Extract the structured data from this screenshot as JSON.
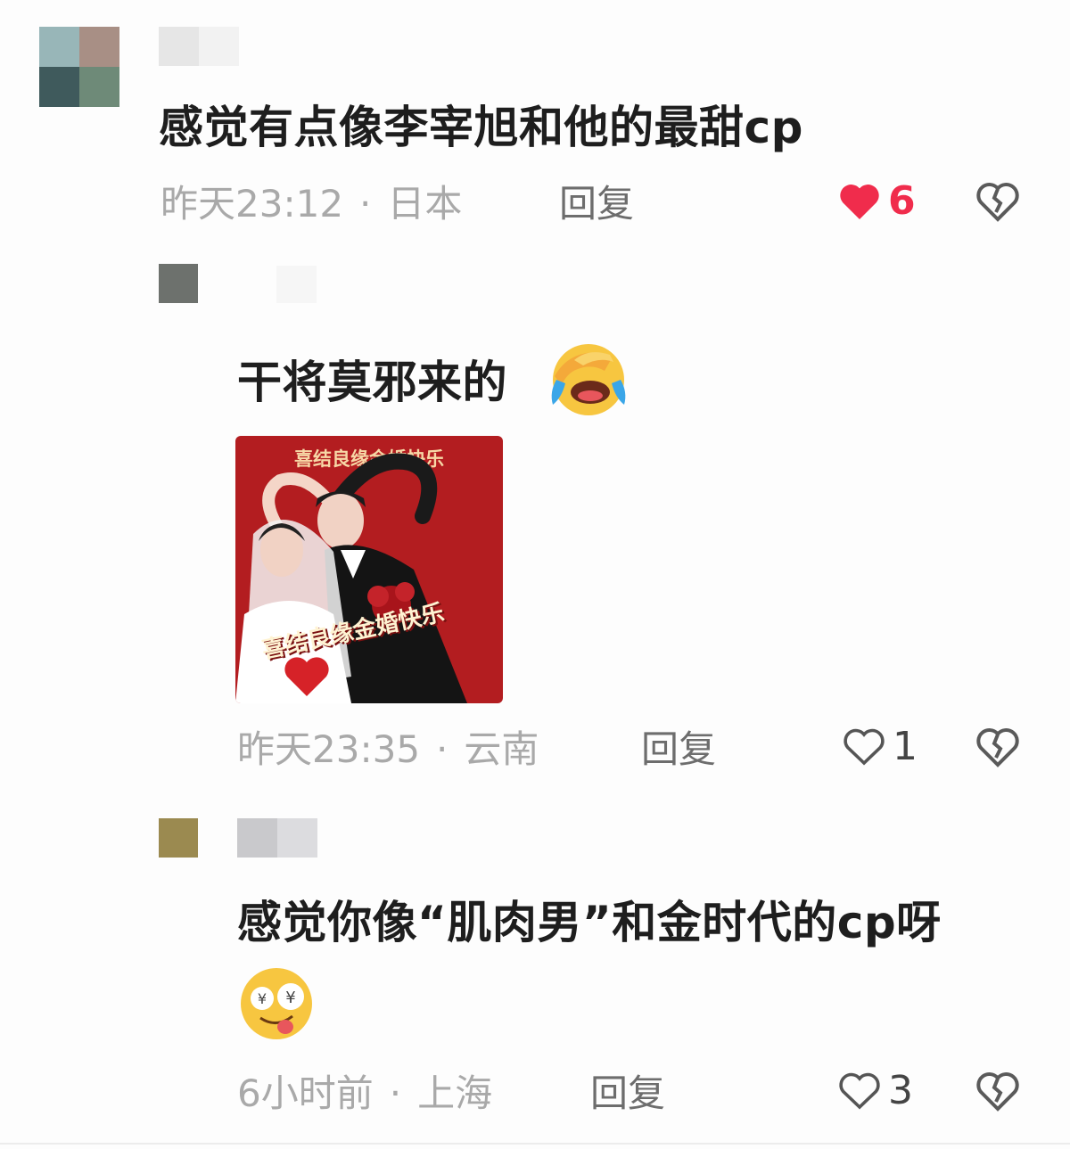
{
  "comments": [
    {
      "text": "感觉有点像李宰旭和他的最甜cp",
      "time": "昨天23:12",
      "separator": "·",
      "location": "日本",
      "reply_label": "回复",
      "likes": "6",
      "liked": true,
      "like_color": "#f02c4c"
    },
    {
      "text": "干将莫邪来的",
      "emoji": "face-palm-crying-icon",
      "time": "昨天23:35",
      "separator": "·",
      "location": "云南",
      "reply_label": "回复",
      "likes": "1",
      "liked": false,
      "image": {
        "banner": "喜结良缘金婚快乐",
        "caption": "喜结良缘金婚快乐"
      }
    },
    {
      "text": "感觉你像“肌肉男”和金时代的cp呀",
      "emoji": "money-eyes-tongue-icon",
      "time": "6小时前",
      "separator": "·",
      "location": "上海",
      "reply_label": "回复",
      "likes": "3",
      "liked": false
    }
  ],
  "colors": {
    "text": "#1e1e1e",
    "meta": "#a9a9a9",
    "reply": "#6d6d6d",
    "like_active": "#f02c4c",
    "photo_bg": "#b31d20"
  }
}
